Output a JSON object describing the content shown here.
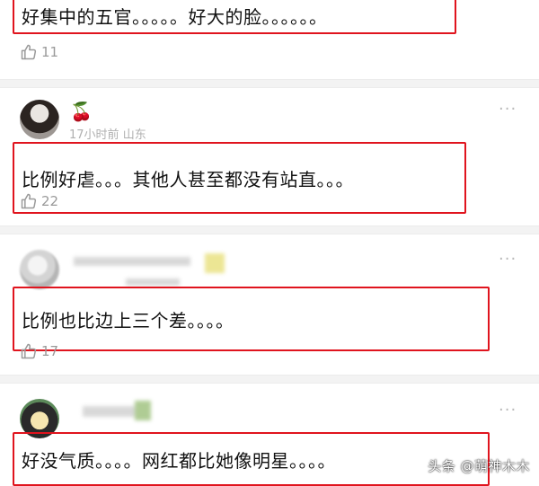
{
  "comments": [
    {
      "text": "好集中的五官。。。。。好大的脸。。。。。。",
      "likes": "11"
    },
    {
      "username": "🍒",
      "time": "17小时前",
      "location": "山东",
      "text": "比例好虐。。。其他人甚至都没有站直。。。",
      "likes": "22"
    },
    {
      "text": "比例也比边上三个差。。。。",
      "likes": "17"
    },
    {
      "text": "好没气质。。。。网红都比她像明星。。。。"
    }
  ],
  "more_glyph": "···",
  "watermark": "头条 @萌神木木",
  "colors": {
    "highlight_border": "#e0141e",
    "separator": "#f3f3f3",
    "meta_text": "#b0b0b0"
  }
}
